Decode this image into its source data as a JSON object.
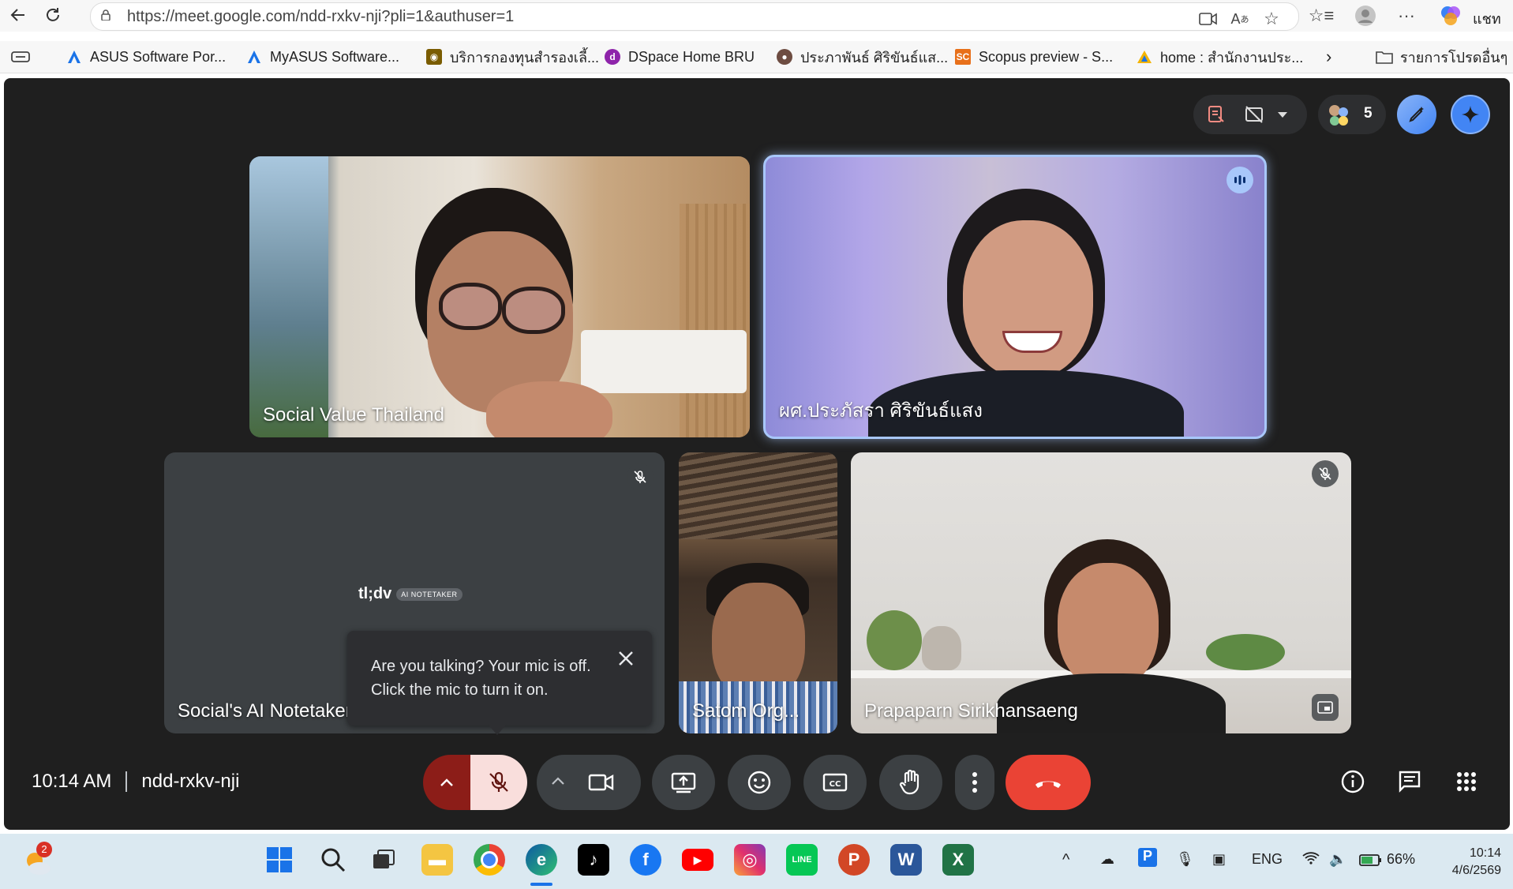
{
  "browser": {
    "url": "https://meet.google.com/ndd-rxkv-nji?pli=1&authuser=1",
    "profile_label": "แชท"
  },
  "bookmarks": [
    {
      "label": "ASUS Software Por...",
      "icon": "asus-triangle-icon",
      "color": "#1a73e8"
    },
    {
      "label": "MyASUS Software...",
      "icon": "asus-triangle-icon",
      "color": "#1a73e8"
    },
    {
      "label": "บริการกองทุนสำรองเลี้...",
      "icon": "fund-logo-icon",
      "color": "#c8a200"
    },
    {
      "label": "DSpace Home BRU",
      "icon": "dspace-icon",
      "color": "#8e24aa"
    },
    {
      "label": "ประภาพันธ์ ศิริขันธ์แส...",
      "icon": "profile-seal-icon",
      "color": "#6d4c41"
    },
    {
      "label": "Scopus preview - S...",
      "icon": "scopus-icon",
      "color": "#e8701a",
      "badge": "SC"
    },
    {
      "label": "home : สำนักงานประ...",
      "icon": "triangle-logo-icon",
      "color": "#f4b400"
    }
  ],
  "bookmarks_other": "รายการโปรดอื่นๆ",
  "meet": {
    "participant_count": "5",
    "time": "10:14 AM",
    "meeting_code": "ndd-rxkv-nji",
    "tiles": [
      {
        "name": "Social Value Thailand"
      },
      {
        "name": "ผศ.ประภัสรา ศิริขันธ์แสง"
      },
      {
        "name": "Social's AI Notetaker",
        "logo": "tl;dv",
        "logo_badge": "AI NOTETAKER"
      },
      {
        "name": "Satom Org..."
      },
      {
        "name": "Prapaparn Sirikhansaeng"
      }
    ],
    "tooltip": "Are you talking? Your mic is off. Click the mic to turn it on.",
    "colors": {
      "end_call": "#ea4335",
      "mic_off_bg": "#f9dedc",
      "accent": "#8ab4f8"
    }
  },
  "taskbar": {
    "weather_badge": "2",
    "language": "ENG",
    "battery": "66%",
    "clock_time": "10:14",
    "clock_date": "4/6/2569"
  }
}
